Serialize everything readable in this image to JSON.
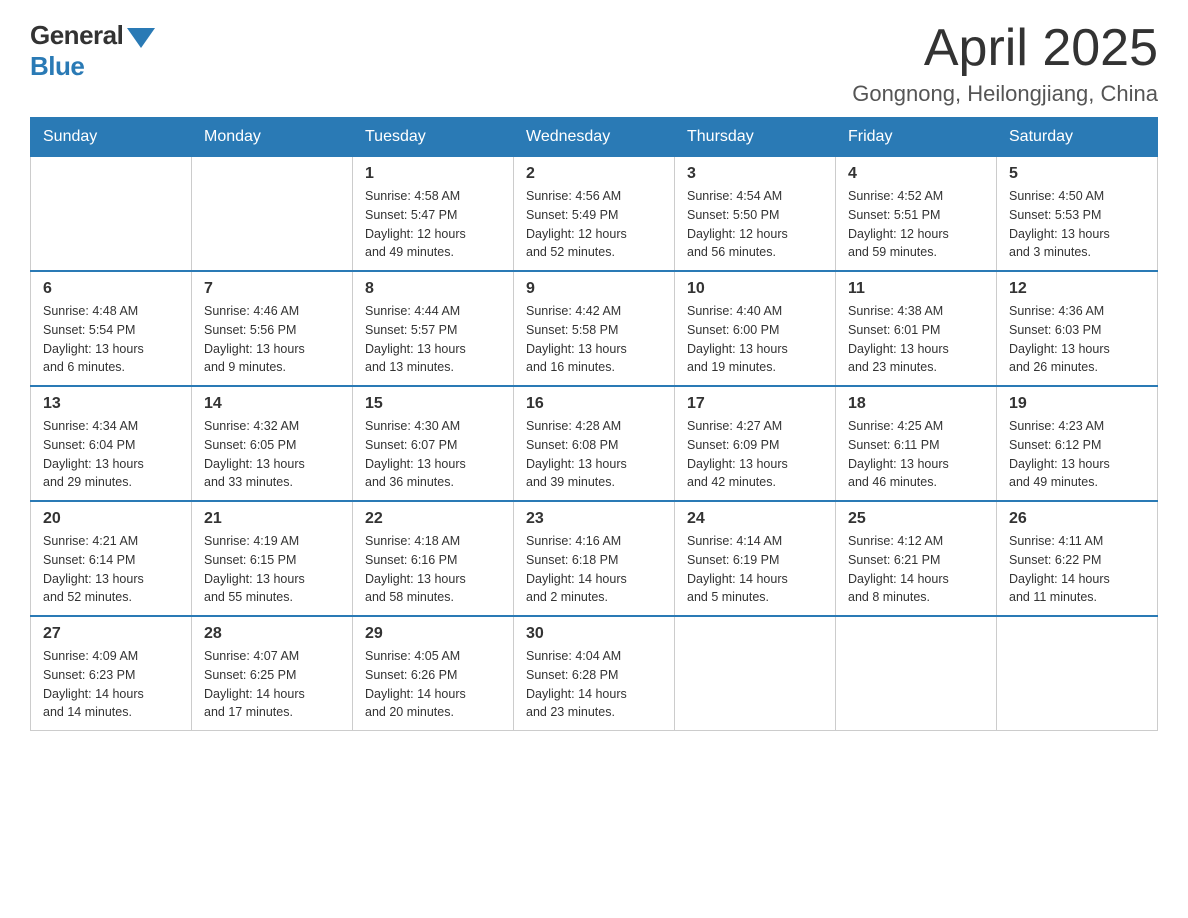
{
  "logo": {
    "general": "General",
    "blue": "Blue"
  },
  "title": "April 2025",
  "location": "Gongnong, Heilongjiang, China",
  "days_of_week": [
    "Sunday",
    "Monday",
    "Tuesday",
    "Wednesday",
    "Thursday",
    "Friday",
    "Saturday"
  ],
  "weeks": [
    [
      {
        "day": "",
        "info": ""
      },
      {
        "day": "",
        "info": ""
      },
      {
        "day": "1",
        "info": "Sunrise: 4:58 AM\nSunset: 5:47 PM\nDaylight: 12 hours\nand 49 minutes."
      },
      {
        "day": "2",
        "info": "Sunrise: 4:56 AM\nSunset: 5:49 PM\nDaylight: 12 hours\nand 52 minutes."
      },
      {
        "day": "3",
        "info": "Sunrise: 4:54 AM\nSunset: 5:50 PM\nDaylight: 12 hours\nand 56 minutes."
      },
      {
        "day": "4",
        "info": "Sunrise: 4:52 AM\nSunset: 5:51 PM\nDaylight: 12 hours\nand 59 minutes."
      },
      {
        "day": "5",
        "info": "Sunrise: 4:50 AM\nSunset: 5:53 PM\nDaylight: 13 hours\nand 3 minutes."
      }
    ],
    [
      {
        "day": "6",
        "info": "Sunrise: 4:48 AM\nSunset: 5:54 PM\nDaylight: 13 hours\nand 6 minutes."
      },
      {
        "day": "7",
        "info": "Sunrise: 4:46 AM\nSunset: 5:56 PM\nDaylight: 13 hours\nand 9 minutes."
      },
      {
        "day": "8",
        "info": "Sunrise: 4:44 AM\nSunset: 5:57 PM\nDaylight: 13 hours\nand 13 minutes."
      },
      {
        "day": "9",
        "info": "Sunrise: 4:42 AM\nSunset: 5:58 PM\nDaylight: 13 hours\nand 16 minutes."
      },
      {
        "day": "10",
        "info": "Sunrise: 4:40 AM\nSunset: 6:00 PM\nDaylight: 13 hours\nand 19 minutes."
      },
      {
        "day": "11",
        "info": "Sunrise: 4:38 AM\nSunset: 6:01 PM\nDaylight: 13 hours\nand 23 minutes."
      },
      {
        "day": "12",
        "info": "Sunrise: 4:36 AM\nSunset: 6:03 PM\nDaylight: 13 hours\nand 26 minutes."
      }
    ],
    [
      {
        "day": "13",
        "info": "Sunrise: 4:34 AM\nSunset: 6:04 PM\nDaylight: 13 hours\nand 29 minutes."
      },
      {
        "day": "14",
        "info": "Sunrise: 4:32 AM\nSunset: 6:05 PM\nDaylight: 13 hours\nand 33 minutes."
      },
      {
        "day": "15",
        "info": "Sunrise: 4:30 AM\nSunset: 6:07 PM\nDaylight: 13 hours\nand 36 minutes."
      },
      {
        "day": "16",
        "info": "Sunrise: 4:28 AM\nSunset: 6:08 PM\nDaylight: 13 hours\nand 39 minutes."
      },
      {
        "day": "17",
        "info": "Sunrise: 4:27 AM\nSunset: 6:09 PM\nDaylight: 13 hours\nand 42 minutes."
      },
      {
        "day": "18",
        "info": "Sunrise: 4:25 AM\nSunset: 6:11 PM\nDaylight: 13 hours\nand 46 minutes."
      },
      {
        "day": "19",
        "info": "Sunrise: 4:23 AM\nSunset: 6:12 PM\nDaylight: 13 hours\nand 49 minutes."
      }
    ],
    [
      {
        "day": "20",
        "info": "Sunrise: 4:21 AM\nSunset: 6:14 PM\nDaylight: 13 hours\nand 52 minutes."
      },
      {
        "day": "21",
        "info": "Sunrise: 4:19 AM\nSunset: 6:15 PM\nDaylight: 13 hours\nand 55 minutes."
      },
      {
        "day": "22",
        "info": "Sunrise: 4:18 AM\nSunset: 6:16 PM\nDaylight: 13 hours\nand 58 minutes."
      },
      {
        "day": "23",
        "info": "Sunrise: 4:16 AM\nSunset: 6:18 PM\nDaylight: 14 hours\nand 2 minutes."
      },
      {
        "day": "24",
        "info": "Sunrise: 4:14 AM\nSunset: 6:19 PM\nDaylight: 14 hours\nand 5 minutes."
      },
      {
        "day": "25",
        "info": "Sunrise: 4:12 AM\nSunset: 6:21 PM\nDaylight: 14 hours\nand 8 minutes."
      },
      {
        "day": "26",
        "info": "Sunrise: 4:11 AM\nSunset: 6:22 PM\nDaylight: 14 hours\nand 11 minutes."
      }
    ],
    [
      {
        "day": "27",
        "info": "Sunrise: 4:09 AM\nSunset: 6:23 PM\nDaylight: 14 hours\nand 14 minutes."
      },
      {
        "day": "28",
        "info": "Sunrise: 4:07 AM\nSunset: 6:25 PM\nDaylight: 14 hours\nand 17 minutes."
      },
      {
        "day": "29",
        "info": "Sunrise: 4:05 AM\nSunset: 6:26 PM\nDaylight: 14 hours\nand 20 minutes."
      },
      {
        "day": "30",
        "info": "Sunrise: 4:04 AM\nSunset: 6:28 PM\nDaylight: 14 hours\nand 23 minutes."
      },
      {
        "day": "",
        "info": ""
      },
      {
        "day": "",
        "info": ""
      },
      {
        "day": "",
        "info": ""
      }
    ]
  ]
}
